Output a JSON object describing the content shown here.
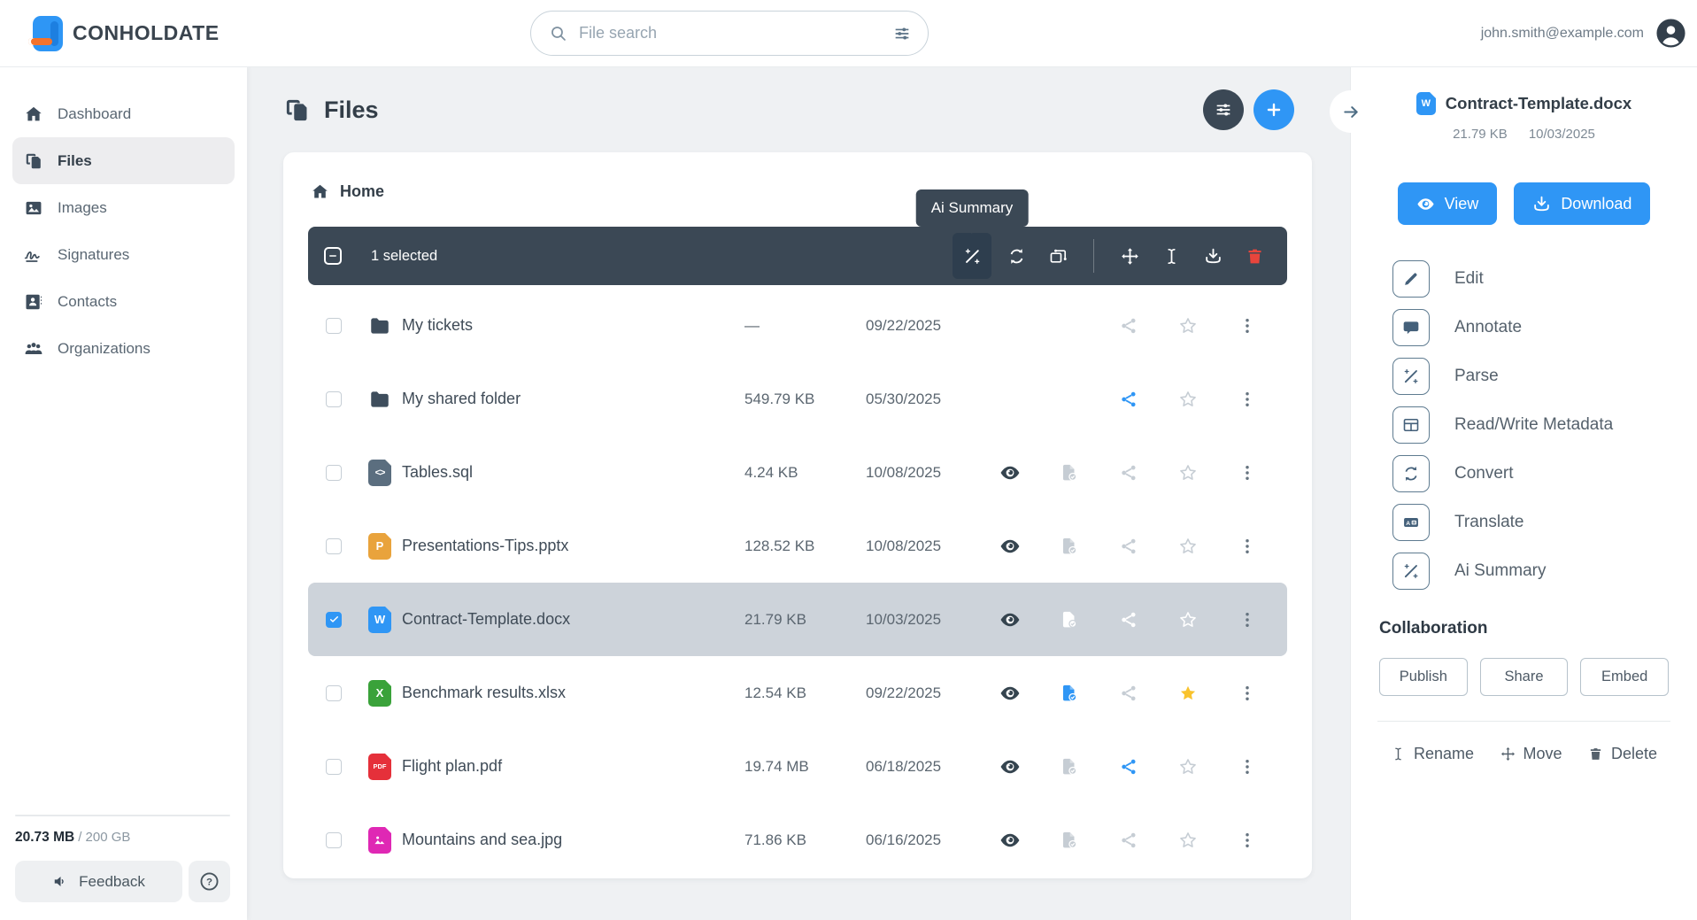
{
  "header": {
    "brand": "CONHOLDATE",
    "search_placeholder": "File search",
    "user_email": "john.smith@example.com"
  },
  "sidebar": {
    "items": [
      {
        "label": "Dashboard",
        "icon": "home",
        "active": false
      },
      {
        "label": "Files",
        "icon": "files",
        "active": true
      },
      {
        "label": "Images",
        "icon": "image",
        "active": false
      },
      {
        "label": "Signatures",
        "icon": "signature",
        "active": false
      },
      {
        "label": "Contacts",
        "icon": "contacts",
        "active": false
      },
      {
        "label": "Organizations",
        "icon": "people",
        "active": false
      }
    ],
    "storage_used": "20.73 MB",
    "storage_rest": "/ 200 GB",
    "feedback_label": "Feedback",
    "help_icon": "question-mark"
  },
  "main": {
    "title": "Files",
    "breadcrumb_home": "Home",
    "header_icons": [
      "filter-settings",
      "add-new"
    ],
    "toolbar": {
      "selected_label": "1 selected",
      "tooltip": "Ai Summary",
      "buttons": [
        {
          "name": "ai-summary",
          "icon": "wand",
          "highlight": true,
          "tooltip": true
        },
        {
          "name": "convert",
          "icon": "refresh"
        },
        {
          "name": "merge",
          "icon": "merge"
        },
        {
          "name": "separator"
        },
        {
          "name": "move",
          "icon": "move"
        },
        {
          "name": "rename",
          "icon": "ibeam"
        },
        {
          "name": "download",
          "icon": "download"
        },
        {
          "name": "delete",
          "icon": "trash",
          "danger": true
        }
      ]
    },
    "file_type_labels": {
      "sql": "<>",
      "pptx": "P",
      "docx": "W",
      "xlsx": "X",
      "pdf": "PDF",
      "jpg": ""
    },
    "files": [
      {
        "name": "My tickets",
        "type": "folder",
        "size": "—",
        "date": "09/22/2025",
        "preview": false,
        "status": "none",
        "share": "gray",
        "star": "off",
        "selected": false
      },
      {
        "name": "My shared folder",
        "type": "folder",
        "size": "549.79 KB",
        "date": "05/30/2025",
        "preview": false,
        "status": "none",
        "share": "blue",
        "star": "off",
        "selected": false
      },
      {
        "name": "Tables.sql",
        "type": "sql",
        "size": "4.24 KB",
        "date": "10/08/2025",
        "preview": true,
        "status": "gray",
        "share": "gray",
        "star": "off",
        "selected": false
      },
      {
        "name": "Presentations-Tips.pptx",
        "type": "pptx",
        "size": "128.52 KB",
        "date": "10/08/2025",
        "preview": true,
        "status": "gray",
        "share": "gray",
        "star": "off",
        "selected": false
      },
      {
        "name": "Contract-Template.docx",
        "type": "docx",
        "size": "21.79 KB",
        "date": "10/03/2025",
        "preview": true,
        "status": "white",
        "share": "white",
        "star": "white",
        "selected": true
      },
      {
        "name": "Benchmark results.xlsx",
        "type": "xlsx",
        "size": "12.54 KB",
        "date": "09/22/2025",
        "preview": true,
        "status": "blue",
        "share": "gray",
        "star": "on",
        "selected": false
      },
      {
        "name": "Flight plan.pdf",
        "type": "pdf",
        "size": "19.74 MB",
        "date": "06/18/2025",
        "preview": true,
        "status": "gray",
        "share": "blue",
        "star": "off",
        "selected": false
      },
      {
        "name": "Mountains and sea.jpg",
        "type": "jpg",
        "size": "71.86 KB",
        "date": "06/16/2025",
        "preview": true,
        "status": "gray",
        "share": "gray",
        "star": "off",
        "selected": false
      }
    ]
  },
  "panel": {
    "file_type": "docx",
    "file_name": "Contract-Template.docx",
    "file_size": "21.79 KB",
    "file_date": "10/03/2025",
    "view_label": "View",
    "download_label": "Download",
    "actions": [
      {
        "icon": "pencil",
        "label": "Edit"
      },
      {
        "icon": "comment",
        "label": "Annotate"
      },
      {
        "icon": "wand",
        "label": "Parse"
      },
      {
        "icon": "table",
        "label": "Read/Write Metadata"
      },
      {
        "icon": "refresh",
        "label": "Convert"
      },
      {
        "icon": "translate",
        "label": "Translate"
      },
      {
        "icon": "wand",
        "label": "Ai Summary"
      }
    ],
    "collaboration_title": "Collaboration",
    "collab_buttons": [
      "Publish",
      "Share",
      "Embed"
    ],
    "footer_actions": [
      {
        "icon": "ibeam",
        "label": "Rename"
      },
      {
        "icon": "move",
        "label": "Move"
      },
      {
        "icon": "trash",
        "label": "Delete"
      }
    ]
  },
  "colors": {
    "accent": "#2f96f5",
    "toolbar_bg": "#3b4855",
    "selected_row": "#cdd3da",
    "star": "#f9c32d",
    "danger": "#e8453c",
    "file_types": {
      "folder": "#3e4d5c",
      "sql": "#5b6e7f",
      "pptx": "#e9a33c",
      "docx": "#2f96f5",
      "xlsx": "#3aa23a",
      "pdf": "#e5303a",
      "jpg": "#df28b4"
    }
  }
}
